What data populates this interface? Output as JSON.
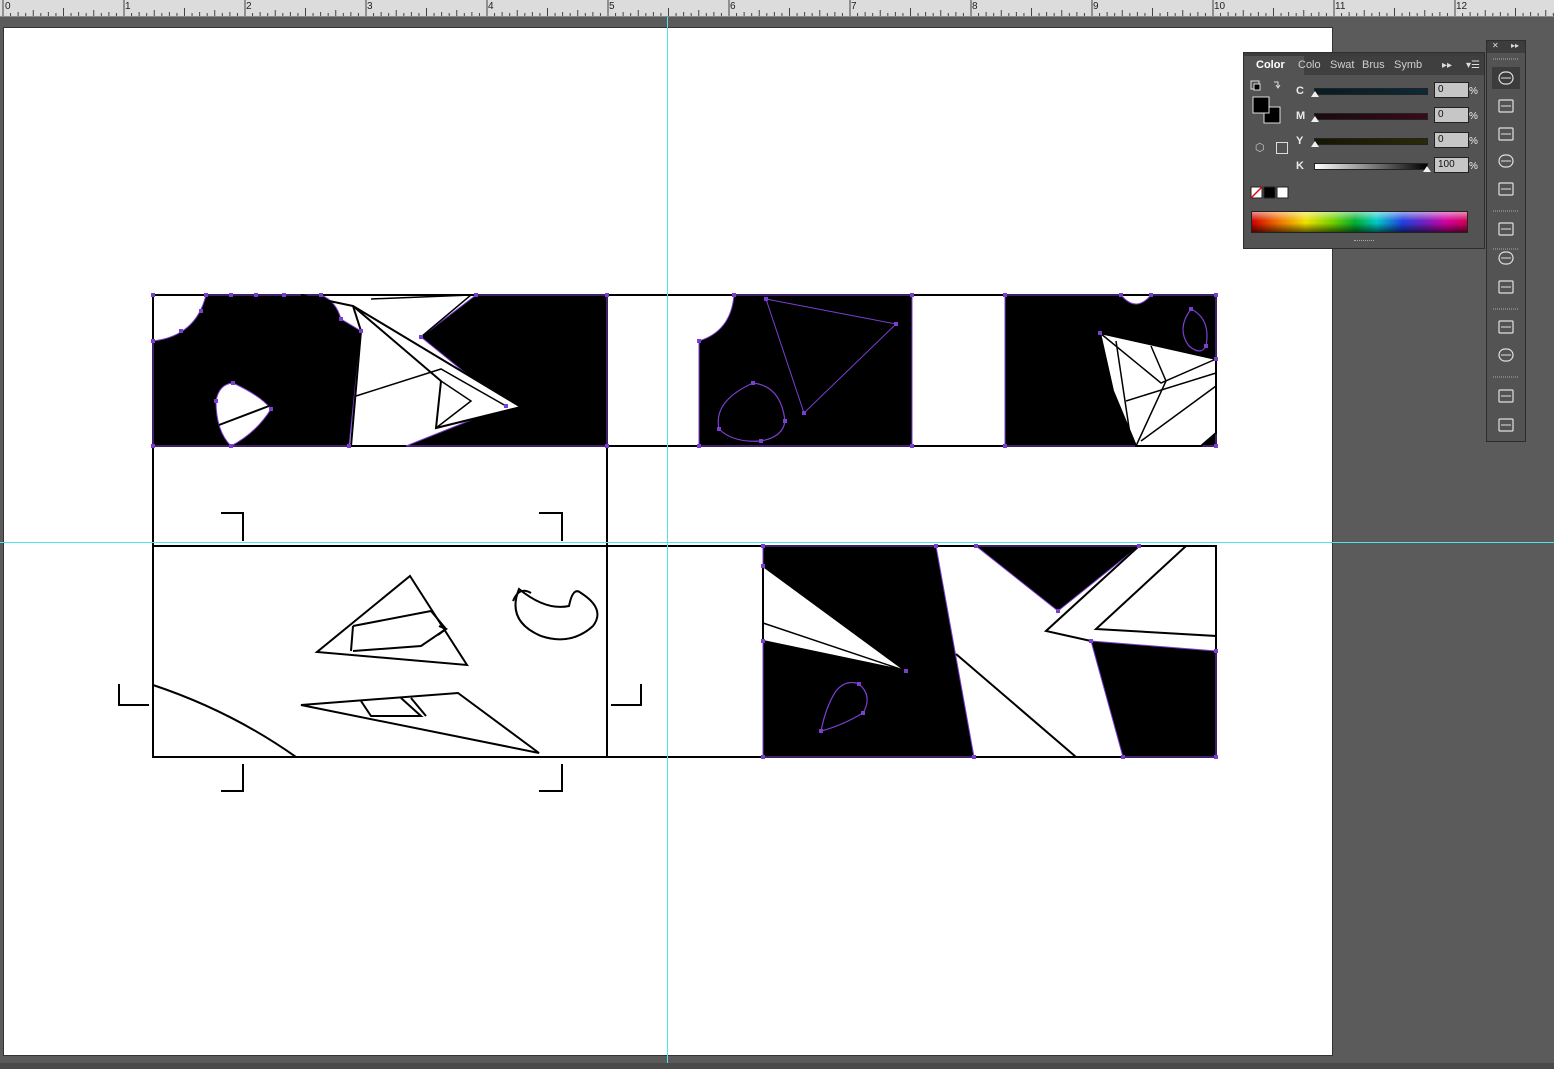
{
  "ruler": {
    "labels": [
      "0",
      "1",
      "2",
      "3",
      "4",
      "5",
      "6",
      "7",
      "8",
      "9",
      "10",
      "11",
      "12"
    ]
  },
  "color_panel": {
    "tabs": {
      "color": "Color",
      "color_guide": "Colo",
      "swatches": "Swat",
      "brushes": "Brus",
      "symbols": "Symb"
    },
    "channels": [
      {
        "label": "C",
        "value": "0",
        "unit": "%"
      },
      {
        "label": "M",
        "value": "0",
        "unit": "%"
      },
      {
        "label": "Y",
        "value": "0",
        "unit": "%"
      },
      {
        "label": "K",
        "value": "100",
        "unit": "%"
      }
    ],
    "fill_color": "#000000",
    "stroke_color": "#000000"
  },
  "tool_dock": {
    "buttons": [
      "color-panel-icon",
      "color-guide-icon",
      "swatches-icon",
      "brushes-icon",
      "symbols-icon",
      "stroke-icon",
      "gradient-icon",
      "transparency-icon",
      "layers-icon",
      "artboards-icon",
      "appearance-icon",
      "graphic-styles-icon"
    ]
  },
  "colors": {
    "guide": "#4fe3ea",
    "selection": "#7b3fd0",
    "workspace": "#5b5b5b"
  }
}
